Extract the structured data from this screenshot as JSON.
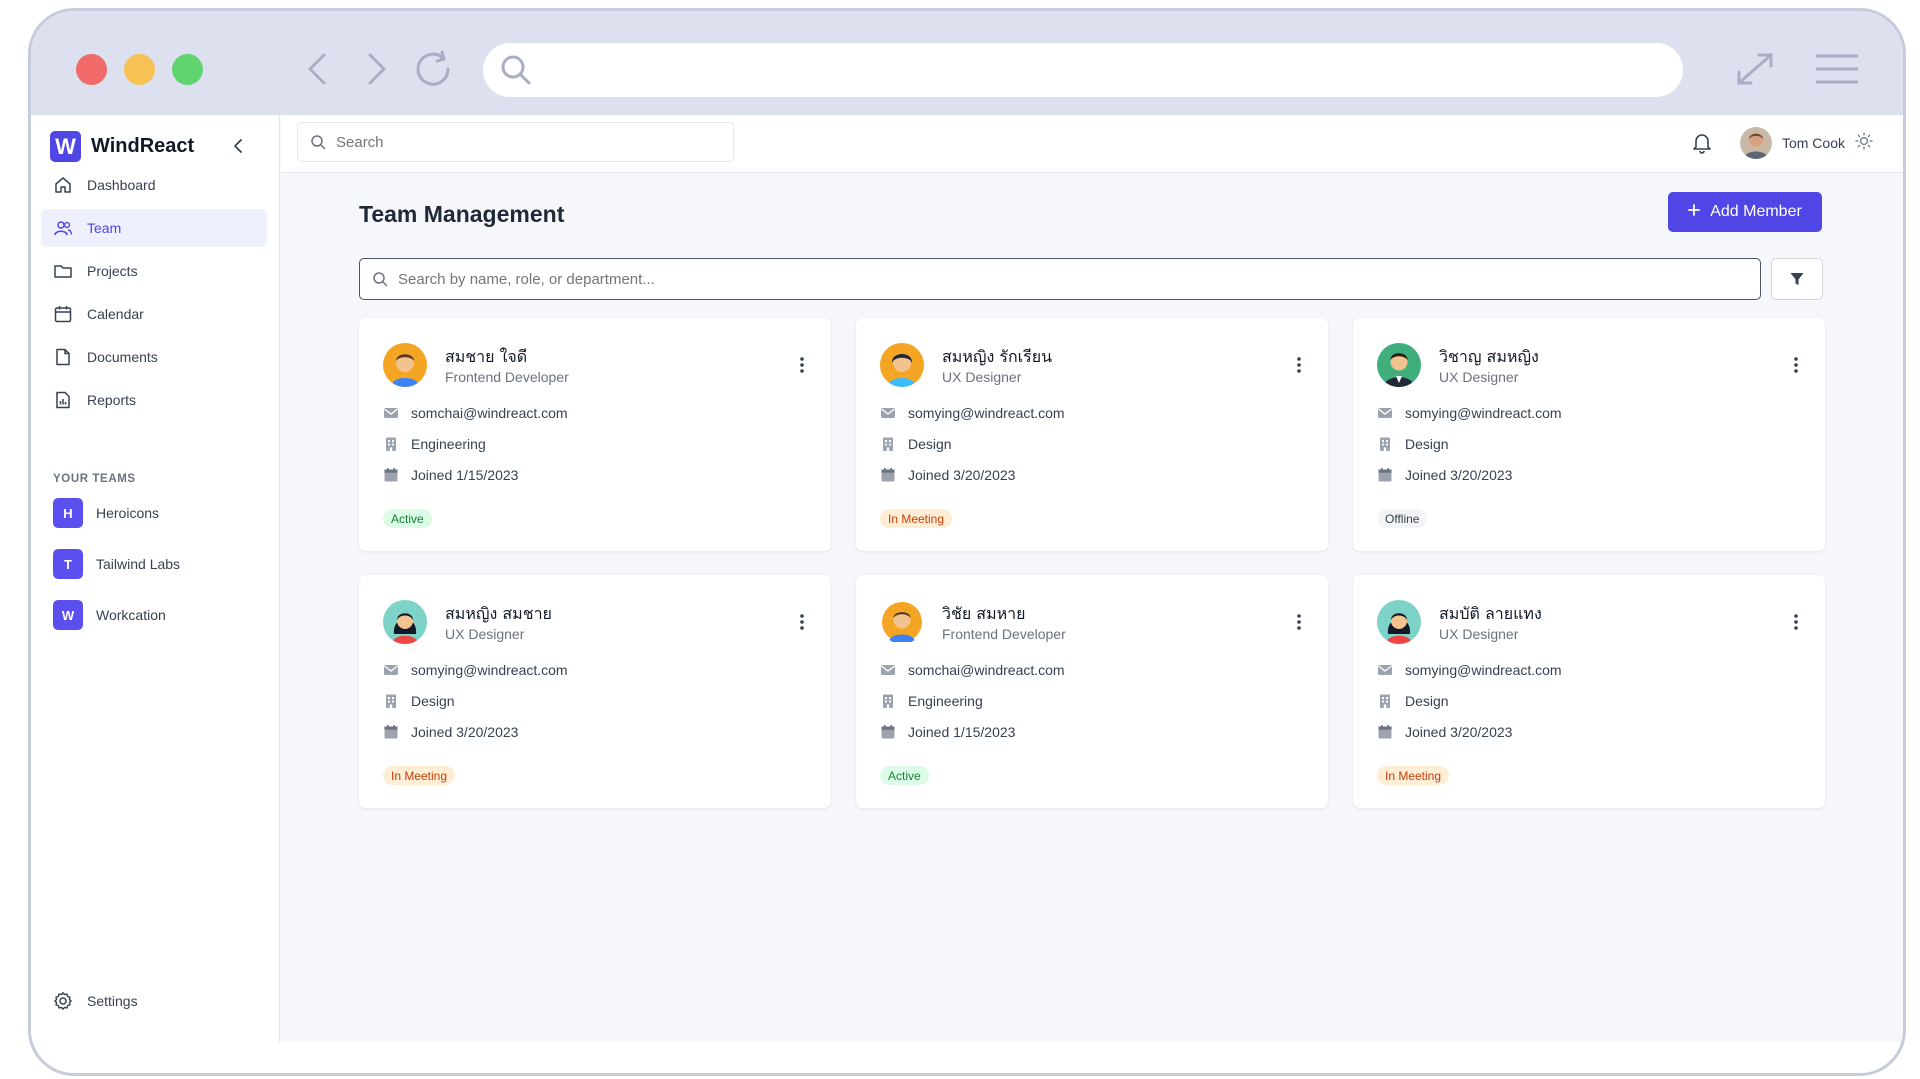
{
  "app": {
    "brand_letter": "W",
    "brand_name": "WindReact"
  },
  "sidebar": {
    "items": [
      {
        "label": "Dashboard",
        "icon": "home-icon",
        "active": false
      },
      {
        "label": "Team",
        "icon": "users-icon",
        "active": true
      },
      {
        "label": "Projects",
        "icon": "folder-icon",
        "active": false
      },
      {
        "label": "Calendar",
        "icon": "calendar-icon",
        "active": false
      },
      {
        "label": "Documents",
        "icon": "document-icon",
        "active": false
      },
      {
        "label": "Reports",
        "icon": "report-icon",
        "active": false
      }
    ],
    "teams_title": "YOUR TEAMS",
    "teams": [
      {
        "initial": "H",
        "label": "Heroicons"
      },
      {
        "initial": "T",
        "label": "Tailwind Labs"
      },
      {
        "initial": "W",
        "label": "Workcation"
      }
    ],
    "settings_label": "Settings"
  },
  "topbar": {
    "search_placeholder": "Search",
    "user_name": "Tom Cook"
  },
  "main": {
    "title": "Team Management",
    "add_button": "Add Member",
    "search_placeholder": "Search by name, role, or department..."
  },
  "members": [
    {
      "name": "สมชาย ใจดี",
      "role": "Frontend Developer",
      "email": "somchai@windreact.com",
      "department": "Engineering",
      "joined": "Joined 1/15/2023",
      "status": "Active",
      "status_type": "active",
      "avatar": "man-orange-avatar"
    },
    {
      "name": "สมหญิง รักเรียน",
      "role": "UX Designer",
      "email": "somying@windreact.com",
      "department": "Design",
      "joined": "Joined 3/20/2023",
      "status": "In Meeting",
      "status_type": "meeting",
      "avatar": "boy-orange-avatar"
    },
    {
      "name": "วิชาญ สมหญิง",
      "role": "UX Designer",
      "email": "somying@windreact.com",
      "department": "Design",
      "joined": "Joined 3/20/2023",
      "status": "Offline",
      "status_type": "offline",
      "avatar": "man-suit-green-avatar"
    },
    {
      "name": "สมหญิง สมชาย",
      "role": "UX Designer",
      "email": "somying@windreact.com",
      "department": "Design",
      "joined": "Joined 3/20/2023",
      "status": "In Meeting",
      "status_type": "meeting",
      "avatar": "woman-teal-avatar"
    },
    {
      "name": "วิชัย สมหาย",
      "role": "Frontend Developer",
      "email": "somchai@windreact.com",
      "department": "Engineering",
      "joined": "Joined 1/15/2023",
      "status": "Active",
      "status_type": "active",
      "avatar": "man-blue-avatar"
    },
    {
      "name": "สมบัติ ลายแทง",
      "role": "UX Designer",
      "email": "somying@windreact.com",
      "department": "Design",
      "joined": "Joined 3/20/2023",
      "status": "In Meeting",
      "status_type": "meeting",
      "avatar": "woman-teal-avatar"
    }
  ],
  "colors": {
    "accent": "#4f46e5",
    "active_bg": "#dcfce7",
    "meeting_bg": "#ffedd5",
    "offline_bg": "#f3f4f6"
  }
}
